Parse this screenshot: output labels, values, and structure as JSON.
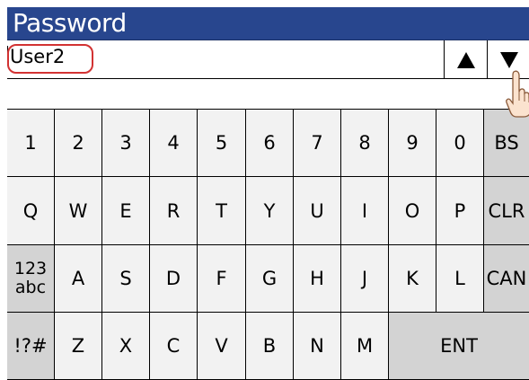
{
  "window": {
    "title": "Password"
  },
  "user": {
    "value": "User2"
  },
  "password_input": {
    "value": ""
  },
  "nav": {
    "up_label": "▲",
    "down_label": "▼"
  },
  "keyboard": {
    "rows": [
      [
        {
          "label": "1"
        },
        {
          "label": "2"
        },
        {
          "label": "3"
        },
        {
          "label": "4"
        },
        {
          "label": "5"
        },
        {
          "label": "6"
        },
        {
          "label": "7"
        },
        {
          "label": "8"
        },
        {
          "label": "9"
        },
        {
          "label": "0"
        },
        {
          "label": "BS",
          "fn": true
        }
      ],
      [
        {
          "label": "Q"
        },
        {
          "label": "W"
        },
        {
          "label": "E"
        },
        {
          "label": "R"
        },
        {
          "label": "T"
        },
        {
          "label": "Y"
        },
        {
          "label": "U"
        },
        {
          "label": "I"
        },
        {
          "label": "O"
        },
        {
          "label": "P"
        },
        {
          "label": "CLR",
          "fn": true
        }
      ],
      [
        {
          "label": "123\nabc",
          "fn": true
        },
        {
          "label": "A"
        },
        {
          "label": "S"
        },
        {
          "label": "D"
        },
        {
          "label": "F"
        },
        {
          "label": "G"
        },
        {
          "label": "H"
        },
        {
          "label": "J"
        },
        {
          "label": "K"
        },
        {
          "label": "L"
        },
        {
          "label": "CAN",
          "fn": true
        }
      ],
      [
        {
          "label": "!?#",
          "fn": true
        },
        {
          "label": "Z"
        },
        {
          "label": "X"
        },
        {
          "label": "C"
        },
        {
          "label": "V"
        },
        {
          "label": "B"
        },
        {
          "label": "N"
        },
        {
          "label": "M"
        },
        {
          "label": "ENT",
          "fn": true,
          "wide": true
        }
      ]
    ]
  },
  "colors": {
    "title_bar": "#28468e",
    "key_bg": "#f2f2f2",
    "function_key_bg": "#d3d3d3",
    "highlight_ring": "#d23232"
  }
}
